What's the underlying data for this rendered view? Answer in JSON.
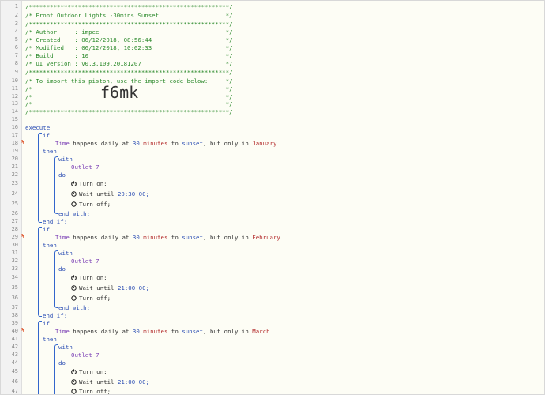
{
  "header": [
    "/*********************************************************/",
    "/* Front Outdoor Lights -30mins Sunset                   */",
    "/*********************************************************/",
    "/* Author     : impee                                    */",
    "/* Created    : 06/12/2018, 08:56:44                     */",
    "/* Modified   : 06/12/2018, 10:02:33                     */",
    "/* Build      : 10                                       */",
    "/* UI version : v0.3.109.20181207                        */",
    "/*********************************************************/",
    "/* To import this piston, use the import code below:     */",
    "/*                                                       */",
    "/*                                                       */",
    "/*                                                       */",
    "/*********************************************************/"
  ],
  "import_code": "f6mk",
  "kw": {
    "execute": "execute",
    "if": "if",
    "then": "then",
    "with": "with",
    "do": "do",
    "end_with": "end with;",
    "end_if": "end if;"
  },
  "cond": {
    "subject": "Time",
    "t1": "happens daily at",
    "num": "30",
    "unit": "minutes",
    "to": "to",
    "sunset": "sunset",
    "t2": ", but only in",
    "months": [
      "January",
      "February",
      "March"
    ]
  },
  "device": "Outlet 7",
  "cmd": {
    "on": "Turn on;",
    "wait": "Wait until",
    "off": "Turn off;",
    "times": [
      "20:30:00;",
      "21:00:00;",
      "21:00:00;"
    ]
  },
  "line_numbers": [
    "1",
    "2",
    "3",
    "4",
    "5",
    "6",
    "7",
    "8",
    "9",
    "10",
    "11",
    "12",
    "13",
    "14",
    "15",
    "16",
    "17",
    "18",
    "19",
    "20",
    "21",
    "22",
    "23",
    "24",
    "25",
    "26",
    "27",
    "28",
    "29",
    "30",
    "31",
    "32",
    "33",
    "34",
    "35",
    "36",
    "37",
    "38",
    "39",
    "40",
    "41",
    "42",
    "43",
    "44",
    "45",
    "46",
    "47"
  ],
  "flag_symbol": "Ϟ"
}
